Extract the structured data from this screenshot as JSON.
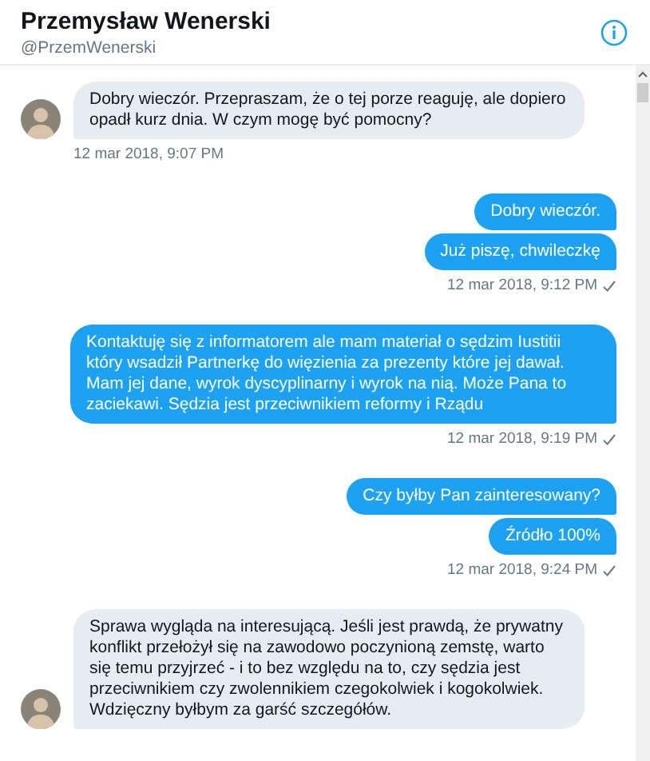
{
  "header": {
    "name": "Przemysław Wenerski",
    "handle": "@PrzemWenerski"
  },
  "groups": [
    {
      "kind": "received",
      "bubbles": [
        "Dobry wieczór. Przepraszam, że o tej porze reaguję, ale dopiero opadł kurz dnia. W czym mogę być pomocny?"
      ],
      "time": "12 mar 2018, 9:07 PM"
    },
    {
      "kind": "sent",
      "bubbles": [
        "Dobry wieczór.",
        "Już piszę, chwileczkę"
      ],
      "time": "12 mar 2018, 9:12 PM",
      "read": true
    },
    {
      "kind": "sent",
      "bubbles": [
        "Kontaktuję się z informatorem ale mam materiał o sędzim Iustitii który wsadził Partnerkę do więzienia za prezenty które jej dawał. Mam jej dane, wyrok dyscyplinarny i wyrok na nią. Może Pana to zaciekawi. Sędzia jest przeciwnikiem reformy i Rządu"
      ],
      "time": "12 mar 2018, 9:19 PM",
      "read": true
    },
    {
      "kind": "sent",
      "bubbles": [
        "Czy byłby Pan zainteresowany?",
        "Źródło 100%"
      ],
      "time": "12 mar 2018, 9:24 PM",
      "read": true
    },
    {
      "kind": "received",
      "bubbles": [
        "Sprawa wygląda na interesującą. Jeśli jest prawdą, że prywatny konflikt przełożył się na zawodowo poczynioną zemstę, warto się temu przyjrzeć - i to bez względu na to, czy sędzia jest przeciwnikiem czy zwolennikiem czegokolwiek i kogokolwiek. Wdzięczny byłbym za garść szczegółów."
      ]
    }
  ]
}
